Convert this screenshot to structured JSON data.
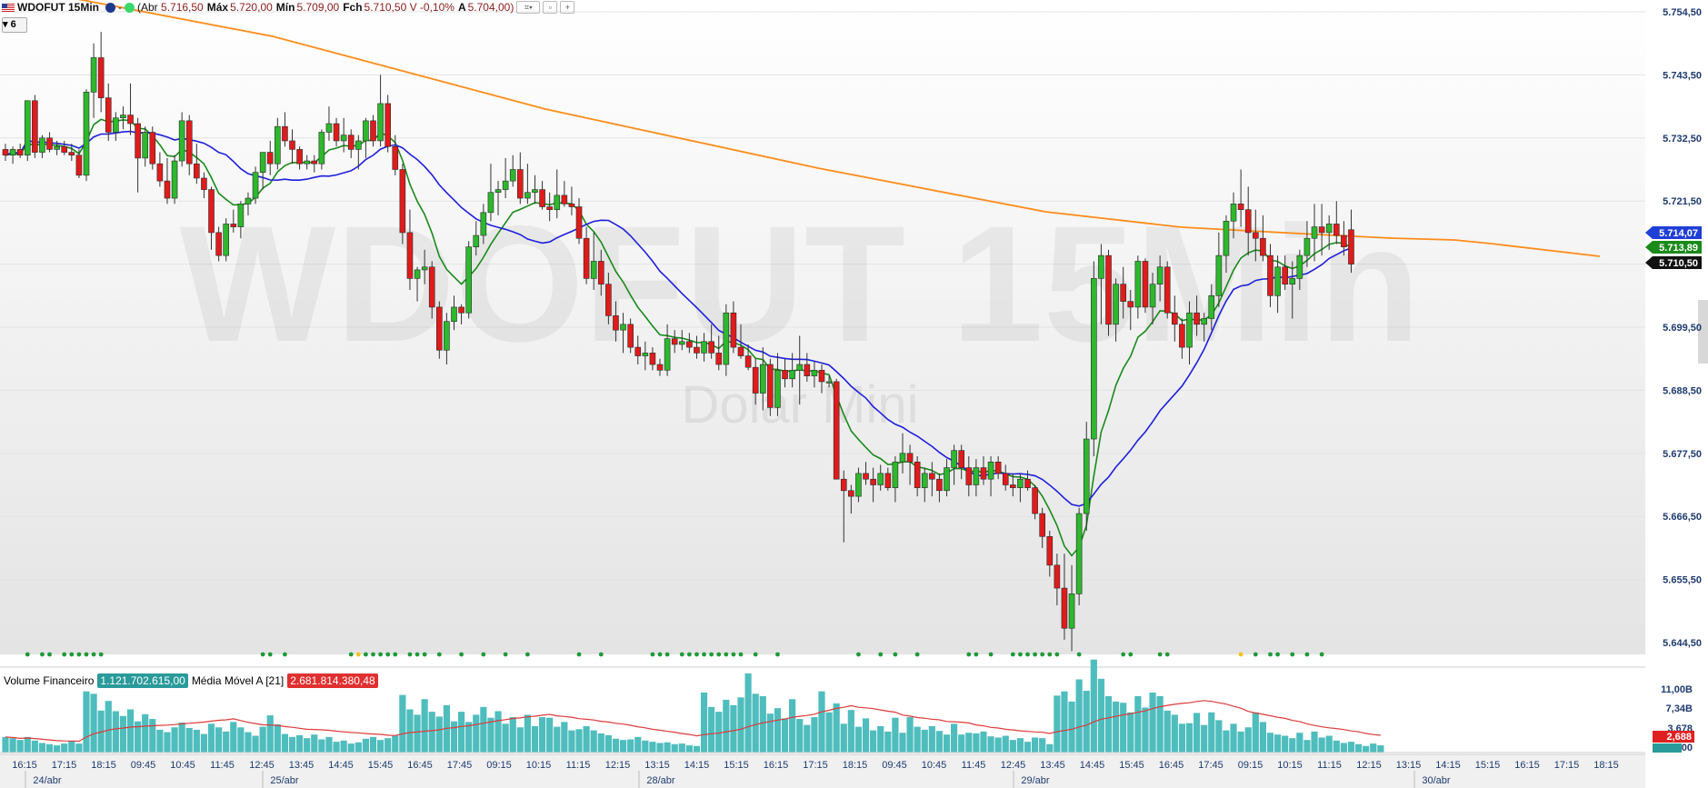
{
  "header": {
    "symbol": "WDOFUT 15Min",
    "abr_label": "(Abr",
    "abr": "5.716,50",
    "max_label": "Máx",
    "max": "5.720,00",
    "min_label": "Mín",
    "min": "5.709,00",
    "fch_label": "Fch",
    "fch": "5.710,50",
    "var": "V -0,10%",
    "a_label": "A",
    "a": "5.704,00)"
  },
  "badge": "6",
  "watermark": {
    "title": "WDOFUT 15Min",
    "subtitle": "Dolar Mini"
  },
  "volume": {
    "label": "Volume Financeiro",
    "value": "1.121.702.615,00",
    "ma_label": "Média Móvel A [21]",
    "ma_value": "2.681.814.380,48",
    "axis_ticks": [
      "11,00B",
      "7,34B",
      "3,678",
      "0,00"
    ],
    "last_label": "2,688"
  },
  "price_axis": {
    "ticks": [
      "5.754,50",
      "5.743,50",
      "5.732,50",
      "5.721,50",
      "5.710,50",
      "5.699,50",
      "5.688,50",
      "5.677,50",
      "5.666,50",
      "5.655,50",
      "5.644,50"
    ],
    "badges": [
      {
        "text": "5.714,07",
        "color": "#1f3fd6"
      },
      {
        "text": "5.713,89",
        "color": "#1a8a1a"
      },
      {
        "text": "5.710,50",
        "color": "#111111"
      }
    ]
  },
  "time_axis": {
    "labels": [
      "16:15",
      "17:15",
      "18:15",
      "09:45",
      "10:45",
      "11:45",
      "12:45",
      "13:45",
      "14:45",
      "15:45",
      "16:45",
      "17:45",
      "09:15",
      "10:15",
      "11:15",
      "12:15",
      "13:15",
      "14:15",
      "15:15",
      "16:15",
      "17:15",
      "18:15",
      "09:45",
      "10:45",
      "11:45",
      "12:45",
      "13:45",
      "14:45",
      "15:45",
      "16:45",
      "17:45",
      "09:15",
      "10:15",
      "11:15",
      "12:15",
      "13:15",
      "14:15",
      "15:15",
      "16:15",
      "17:15",
      "18:15"
    ],
    "dates": [
      "24/abr",
      "25/abr",
      "28/abr",
      "29/abr",
      "30/abr"
    ]
  },
  "colors": {
    "up": "#2db82d",
    "down": "#e01b1b",
    "ma_fast": "#1a8a1a",
    "ma_mid": "#1f1fdc",
    "ma_slow": "#ff8c1a",
    "volume": "#4fbdbd",
    "volume_ma": "#dd3a3a"
  },
  "chart_data": {
    "type": "candlestick",
    "title": "WDOFUT 15Min",
    "ylim": [
      5641,
      5757
    ],
    "candles": [
      [
        5730.5,
        5731.5,
        5728.5,
        5729.5
      ],
      [
        5729.5,
        5731,
        5728,
        5730.5
      ],
      [
        5730.5,
        5731.5,
        5729,
        5729.5
      ],
      [
        5729.5,
        5739,
        5728.5,
        5739
      ],
      [
        5739,
        5740,
        5729,
        5730
      ],
      [
        5730,
        5733,
        5729,
        5732.5
      ],
      [
        5732.5,
        5733.5,
        5730,
        5730.5
      ],
      [
        5730.5,
        5732,
        5729.5,
        5731
      ],
      [
        5731,
        5732,
        5729.5,
        5730
      ],
      [
        5730,
        5731.5,
        5728.5,
        5729.5
      ],
      [
        5729.5,
        5730.5,
        5725.5,
        5726
      ],
      [
        5726,
        5741,
        5725,
        5740.5
      ],
      [
        5740.5,
        5749,
        5736,
        5746.5
      ],
      [
        5746.5,
        5751,
        5737,
        5739.5
      ],
      [
        5739.5,
        5742,
        5732,
        5733.5
      ],
      [
        5733.5,
        5737,
        5732,
        5736
      ],
      [
        5736,
        5738,
        5734,
        5736.5
      ],
      [
        5736.5,
        5742,
        5733,
        5735
      ],
      [
        5735,
        5736,
        5723,
        5729
      ],
      [
        5729,
        5734.5,
        5727.5,
        5733.5
      ],
      [
        5733.5,
        5734.5,
        5727,
        5728
      ],
      [
        5728,
        5730,
        5724,
        5725
      ],
      [
        5725,
        5729,
        5721,
        5722
      ],
      [
        5722,
        5729.5,
        5721,
        5728.5
      ],
      [
        5728.5,
        5737,
        5727.5,
        5735.5
      ],
      [
        5735.5,
        5736.5,
        5726,
        5728
      ],
      [
        5728,
        5731.5,
        5724.5,
        5725.5
      ],
      [
        5725.5,
        5726.5,
        5722,
        5723.5
      ],
      [
        5723.5,
        5724,
        5713,
        5716
      ],
      [
        5716,
        5717,
        5711,
        5712
      ],
      [
        5712,
        5718.5,
        5711,
        5717.5
      ],
      [
        5717.5,
        5720,
        5716,
        5717
      ],
      [
        5717,
        5721.5,
        5715,
        5721
      ],
      [
        5721,
        5723,
        5719,
        5722
      ],
      [
        5722,
        5727.5,
        5721,
        5726.5
      ],
      [
        5726.5,
        5730,
        5723.5,
        5730
      ],
      [
        5730,
        5732,
        5726,
        5728
      ],
      [
        5728,
        5736,
        5727,
        5734.5
      ],
      [
        5734.5,
        5737,
        5731,
        5732
      ],
      [
        5732,
        5734,
        5728,
        5730.5
      ],
      [
        5730.5,
        5731,
        5727,
        5728
      ],
      [
        5728,
        5729.5,
        5727,
        5728.5
      ],
      [
        5728.5,
        5729.5,
        5726.5,
        5728
      ],
      [
        5728,
        5734,
        5727,
        5733.5
      ],
      [
        5733.5,
        5738,
        5732,
        5735
      ],
      [
        5735,
        5736,
        5731,
        5732
      ],
      [
        5732,
        5736,
        5730,
        5733
      ],
      [
        5733,
        5734,
        5729,
        5730.5
      ],
      [
        5730.5,
        5733,
        5727,
        5732
      ],
      [
        5732,
        5736,
        5729,
        5735.5
      ],
      [
        5735.5,
        5736.5,
        5731,
        5732
      ],
      [
        5732,
        5743.5,
        5731,
        5738.5
      ],
      [
        5738.5,
        5740,
        5730,
        5731
      ],
      [
        5731,
        5733,
        5726,
        5727
      ],
      [
        5727,
        5728,
        5714,
        5716
      ],
      [
        5716,
        5720,
        5706,
        5708
      ],
      [
        5708,
        5710,
        5704,
        5709.5
      ],
      [
        5709.5,
        5713,
        5707,
        5710
      ],
      [
        5710,
        5711,
        5701,
        5703
      ],
      [
        5703,
        5704,
        5694,
        5695.5
      ],
      [
        5695.5,
        5702,
        5693,
        5700.5
      ],
      [
        5700.5,
        5705,
        5699,
        5703
      ],
      [
        5703,
        5703.5,
        5700,
        5702
      ],
      [
        5702,
        5714.5,
        5701,
        5713.5
      ],
      [
        5713.5,
        5718,
        5712,
        5715.5
      ],
      [
        5715.5,
        5721,
        5714,
        5719.5
      ],
      [
        5719.5,
        5728,
        5718,
        5723
      ],
      [
        5723,
        5725,
        5719,
        5723.5
      ],
      [
        5723.5,
        5729,
        5722,
        5725
      ],
      [
        5725,
        5729.5,
        5724,
        5727
      ],
      [
        5727,
        5730,
        5721,
        5722
      ],
      [
        5722,
        5728,
        5721,
        5723
      ],
      [
        5723,
        5726,
        5721,
        5723.5
      ],
      [
        5723.5,
        5725,
        5720,
        5720.5
      ],
      [
        5720.5,
        5723,
        5718,
        5720
      ],
      [
        5720,
        5727,
        5718.5,
        5722.5
      ],
      [
        5722.5,
        5725,
        5720.5,
        5721
      ],
      [
        5721,
        5724,
        5719,
        5720.5
      ],
      [
        5720.5,
        5722,
        5714,
        5715
      ],
      [
        5715,
        5717,
        5707,
        5708
      ],
      [
        5708,
        5716,
        5706,
        5711
      ],
      [
        5711,
        5713,
        5705,
        5707
      ],
      [
        5707,
        5709,
        5700,
        5701.5
      ],
      [
        5701.5,
        5704,
        5697,
        5699
      ],
      [
        5699,
        5702,
        5695,
        5700
      ],
      [
        5700,
        5701,
        5695,
        5696
      ],
      [
        5696,
        5698,
        5693,
        5694.5
      ],
      [
        5694.5,
        5697,
        5692,
        5695
      ],
      [
        5695,
        5696,
        5692,
        5693
      ],
      [
        5693,
        5694,
        5691,
        5692
      ],
      [
        5692,
        5700,
        5691,
        5697.5
      ],
      [
        5697.5,
        5699,
        5695,
        5696.5
      ],
      [
        5696.5,
        5699,
        5695.5,
        5697
      ],
      [
        5697,
        5698.5,
        5695,
        5696
      ],
      [
        5696,
        5698,
        5694,
        5695
      ],
      [
        5695,
        5698.5,
        5693.5,
        5697
      ],
      [
        5697,
        5700,
        5694,
        5695
      ],
      [
        5695,
        5698,
        5692,
        5693
      ],
      [
        5693,
        5703.5,
        5691,
        5702
      ],
      [
        5702,
        5704,
        5695,
        5696
      ],
      [
        5696,
        5700,
        5694,
        5694.5
      ],
      [
        5694.5,
        5696.5,
        5692,
        5692.5
      ],
      [
        5692.5,
        5694,
        5686,
        5688
      ],
      [
        5688,
        5696,
        5685,
        5693
      ],
      [
        5693,
        5694,
        5684,
        5685.5
      ],
      [
        5685.5,
        5695,
        5684,
        5692
      ],
      [
        5692,
        5694,
        5689,
        5690.5
      ],
      [
        5690.5,
        5695,
        5689,
        5692
      ],
      [
        5692,
        5698,
        5686,
        5693
      ],
      [
        5693,
        5695,
        5690,
        5691
      ],
      [
        5691,
        5693.5,
        5689,
        5692
      ],
      [
        5692,
        5693,
        5688,
        5690
      ],
      [
        5690,
        5691,
        5689,
        5690
      ],
      [
        5690,
        5690.5,
        5674,
        5673
      ],
      [
        5673,
        5674.5,
        5662,
        5671
      ],
      [
        5671,
        5672,
        5667,
        5670
      ],
      [
        5670,
        5675,
        5669,
        5674
      ],
      [
        5674,
        5676,
        5672,
        5673
      ],
      [
        5673,
        5675,
        5669,
        5672
      ],
      [
        5672,
        5675.5,
        5671,
        5674
      ],
      [
        5674,
        5675,
        5671,
        5671.5
      ],
      [
        5671.5,
        5677,
        5669,
        5676
      ],
      [
        5676,
        5681,
        5674,
        5677.5
      ],
      [
        5677.5,
        5679,
        5672,
        5676
      ],
      [
        5676,
        5677,
        5670,
        5671.5
      ],
      [
        5671.5,
        5675,
        5669,
        5674
      ],
      [
        5674,
        5676,
        5670,
        5673
      ],
      [
        5673,
        5674,
        5669,
        5671
      ],
      [
        5671,
        5676.5,
        5670,
        5675
      ],
      [
        5675,
        5679,
        5672,
        5678
      ],
      [
        5678,
        5679,
        5673,
        5675
      ],
      [
        5675,
        5677,
        5670,
        5672
      ],
      [
        5672,
        5676.5,
        5670,
        5675
      ],
      [
        5675,
        5677,
        5672,
        5673
      ],
      [
        5673,
        5677,
        5670,
        5676
      ],
      [
        5676,
        5677,
        5673,
        5674
      ],
      [
        5674,
        5675.5,
        5671,
        5672
      ],
      [
        5672,
        5674,
        5670,
        5671.5
      ],
      [
        5671.5,
        5674,
        5669,
        5673
      ],
      [
        5673,
        5674.5,
        5671,
        5671.5
      ],
      [
        5671.5,
        5672,
        5666,
        5667
      ],
      [
        5667,
        5668,
        5661,
        5663
      ],
      [
        5663,
        5664,
        5656,
        5658
      ],
      [
        5658,
        5660,
        5651,
        5654
      ],
      [
        5654,
        5660,
        5645,
        5647
      ],
      [
        5647,
        5658,
        5643,
        5653
      ],
      [
        5653,
        5668,
        5651,
        5667
      ],
      [
        5667,
        5683,
        5664,
        5680
      ],
      [
        5680,
        5711,
        5677,
        5708
      ],
      [
        5708,
        5714,
        5700,
        5712
      ],
      [
        5712,
        5713,
        5698,
        5700
      ],
      [
        5700,
        5708,
        5697,
        5707
      ],
      [
        5707,
        5710,
        5701,
        5704
      ],
      [
        5704,
        5706,
        5699,
        5703
      ],
      [
        5703,
        5712,
        5701,
        5711
      ],
      [
        5711,
        5711.5,
        5702,
        5703
      ],
      [
        5703,
        5709,
        5700,
        5707
      ],
      [
        5707,
        5712,
        5704,
        5710
      ],
      [
        5710,
        5711,
        5701,
        5702
      ],
      [
        5702,
        5705,
        5697,
        5700
      ],
      [
        5700,
        5701,
        5694,
        5696
      ],
      [
        5696,
        5704,
        5693,
        5702
      ],
      [
        5702,
        5705,
        5698,
        5700
      ],
      [
        5700,
        5702,
        5697,
        5701
      ],
      [
        5701,
        5707,
        5699,
        5705
      ],
      [
        5705,
        5716,
        5703,
        5712
      ],
      [
        5712,
        5719,
        5709,
        5718
      ],
      [
        5718,
        5723,
        5715,
        5721
      ],
      [
        5721,
        5727,
        5717,
        5720
      ],
      [
        5720,
        5724,
        5712,
        5716
      ],
      [
        5716,
        5720,
        5711,
        5715
      ],
      [
        5715,
        5719,
        5711,
        5712
      ],
      [
        5712,
        5714,
        5703,
        5705
      ],
      [
        5705,
        5712,
        5702,
        5710
      ],
      [
        5710,
        5712,
        5706,
        5707
      ],
      [
        5707,
        5711,
        5701,
        5708
      ],
      [
        5708,
        5713,
        5706,
        5712
      ],
      [
        5712,
        5718,
        5710,
        5715
      ],
      [
        5715,
        5721,
        5711,
        5717
      ],
      [
        5717,
        5721,
        5712,
        5716
      ],
      [
        5716,
        5719,
        5713,
        5717.5
      ],
      [
        5717.5,
        5721.5,
        5714,
        5715.5
      ],
      [
        5715.5,
        5718,
        5712,
        5713.5
      ],
      [
        5716.5,
        5720,
        5709,
        5710.5
      ]
    ],
    "volume": [
      2.6,
      2.4,
      2.1,
      2.6,
      2.0,
      1.6,
      1.4,
      1.2,
      1.5,
      1.9,
      1.5,
      10.2,
      9.8,
      7.0,
      8.6,
      6.9,
      6.1,
      7.2,
      5.2,
      6.4,
      5.6,
      3.8,
      3.4,
      4.2,
      5.0,
      4.1,
      3.8,
      3.1,
      4.8,
      4.2,
      3.5,
      5.1,
      4.2,
      3.4,
      2.8,
      4.3,
      6.2,
      4.7,
      3.1,
      2.6,
      2.9,
      2.4,
      3.0,
      2.2,
      2.6,
      1.8,
      2.0,
      1.5,
      1.7,
      2.3,
      2.6,
      2.1,
      2.4,
      2.8,
      9.6,
      7.2,
      6.3,
      8.9,
      6.8,
      6.0,
      7.9,
      5.2,
      6.8,
      5.1,
      6.3,
      7.6,
      5.8,
      6.9,
      4.8,
      5.9,
      4.2,
      6.3,
      4.4,
      5.9,
      5.8,
      4.3,
      5.1,
      3.7,
      3.9,
      4.4,
      3.7,
      3.2,
      2.9,
      2.3,
      2.1,
      2.2,
      2.6,
      2.0,
      1.8,
      1.6,
      1.7,
      1.4,
      1.5,
      1.2,
      1.1,
      10.0,
      7.6,
      6.8,
      8.8,
      7.9,
      9.2,
      13.2,
      9.8,
      9.4,
      6.5,
      7.4,
      5.7,
      8.9,
      5.6,
      4.6,
      5.9,
      10.2,
      6.7,
      8.2,
      4.8,
      7.1,
      4.3,
      5.7,
      3.7,
      4.4,
      3.5,
      5.8,
      3.3,
      5.9,
      4.3,
      3.8,
      4.4,
      3.6,
      3.0,
      4.8,
      3.0,
      3.3,
      3.2,
      3.5,
      2.7,
      2.5,
      2.8,
      2.1,
      2.4,
      1.8,
      2.5,
      2.4,
      1.4,
      9.5,
      10.2,
      8.5,
      12.2,
      10.3,
      15.5,
      12.3,
      9.4,
      8.5,
      8.3,
      6.7,
      9.4,
      7.5,
      10.0,
      9.4,
      7.0,
      6.3,
      4.8,
      4.9,
      6.6,
      4.6,
      6.7,
      5.4,
      3.7,
      4.8,
      3.5,
      4.2,
      6.7,
      5.1,
      3.3,
      3.0,
      2.8,
      2.4,
      3.3,
      2.1,
      3.5,
      2.5,
      2.8,
      2.0,
      1.6,
      1.8,
      1.4,
      1.1,
      1.5,
      1.2
    ],
    "green_dots": [
      3,
      5,
      6,
      8,
      9,
      10,
      11,
      12,
      13,
      35,
      36,
      38,
      47,
      49,
      50,
      51,
      52,
      53,
      55,
      56,
      57,
      59,
      62,
      65,
      68,
      71,
      78,
      81,
      88,
      89,
      90,
      92,
      93,
      94,
      95,
      96,
      97,
      98,
      99,
      100,
      102,
      105,
      116,
      119,
      121,
      124,
      131,
      132,
      134,
      137,
      138,
      139,
      140,
      141,
      142,
      143,
      146,
      152,
      153,
      157,
      158,
      170,
      172,
      173,
      175,
      177,
      179
    ],
    "yellow_dots": [
      48,
      168
    ],
    "ma_fast": "green moving average",
    "ma_mid": "blue moving average",
    "ma_slow": "orange moving average"
  }
}
